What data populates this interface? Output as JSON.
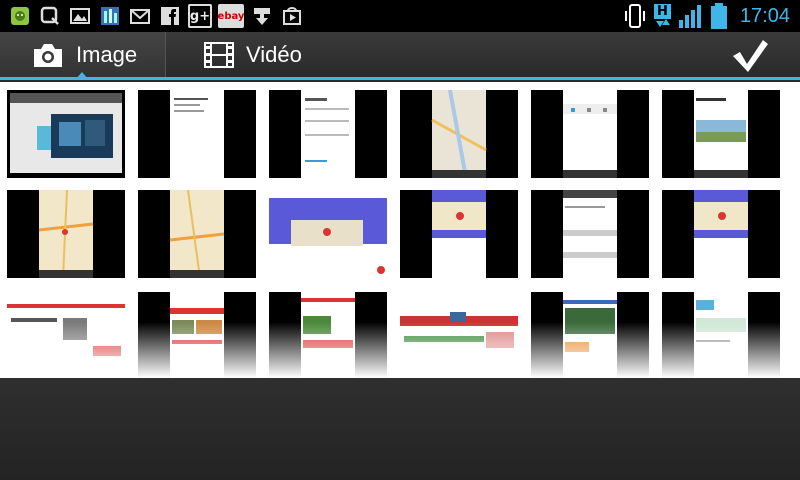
{
  "status_bar": {
    "time": "17:04",
    "notification_icons": [
      "android-icon",
      "q-icon",
      "gallery-icon",
      "app-icon",
      "gmail-icon",
      "facebook-icon",
      "google-plus-icon",
      "ebay-icon",
      "download-icon",
      "play-store-icon"
    ],
    "ebay_label": "ebay",
    "gplus_label": "g+",
    "network_label": "H"
  },
  "tabs": [
    {
      "label": "Image",
      "icon": "camera-icon",
      "selected": true
    },
    {
      "label": "Vidéo",
      "icon": "film-icon",
      "selected": false
    }
  ],
  "confirm_icon": "checkmark-icon",
  "accent_color": "#3fb6e8",
  "thumbnails": [
    "screenshot-1",
    "screenshot-2",
    "screenshot-3",
    "screenshot-4",
    "screenshot-5",
    "screenshot-6",
    "screenshot-7",
    "screenshot-8",
    "screenshot-9",
    "screenshot-10",
    "screenshot-11",
    "screenshot-12",
    "screenshot-13",
    "screenshot-14",
    "screenshot-15",
    "screenshot-16",
    "screenshot-17",
    "screenshot-18"
  ]
}
